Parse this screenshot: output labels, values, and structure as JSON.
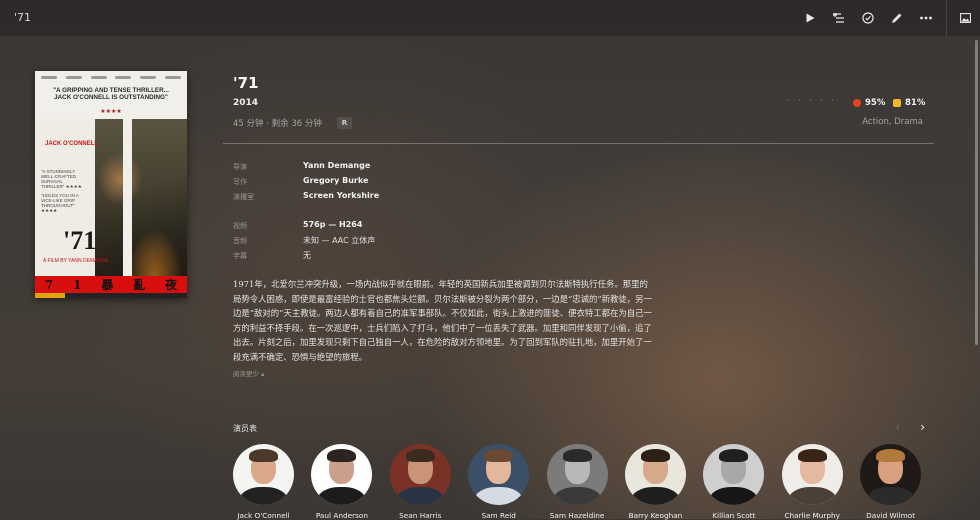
{
  "window": {
    "title": "'71"
  },
  "toolbar": {
    "icons": [
      "play-icon",
      "add-to-queue-icon",
      "watched-check-icon",
      "edit-pencil-icon",
      "more-ellipsis-icon",
      "artwork-image-icon"
    ]
  },
  "poster": {
    "quote": "\"A GRIPPING AND TENSE THRILLER... JACK O'CONNELL IS OUTSTANDING\"",
    "stars": "★★★★",
    "actor": "JACK O'CONNELL",
    "quote2": "\"A STUNNINGLY WELL-CRAFTED SURVIVAL THRILLER\" ★★★★",
    "quote3": "\"HOLDS YOU IN A VICE-LIKE GRIP THROUGHOUT\" ★★★★",
    "title": "'71",
    "director": "A FILM BY YANN DEMANGE",
    "chinese_title": [
      "7",
      "1",
      "暴",
      "亂",
      "夜"
    ],
    "progress": 0.2
  },
  "header": {
    "title": "'71",
    "year": "2014",
    "meta": "45 分钟 · 剩余 36 分钟",
    "content_rating": "R",
    "dots": "· · · · ·",
    "critic_score": "95%",
    "audience_score": "81%",
    "genres": "Action, Drama",
    "colors": {
      "critic": "#e2461f",
      "audience": "#f5b629"
    }
  },
  "credits": [
    {
      "label": "导演",
      "value": "Yann Demange"
    },
    {
      "label": "写作",
      "value": "Gregory Burke"
    },
    {
      "label": "演播室",
      "value": "Screen Yorkshire"
    }
  ],
  "media": [
    {
      "label": "视频",
      "value": "576p — H264"
    },
    {
      "label": "音频",
      "value": "未知 — AAC 立体声"
    },
    {
      "label": "字幕",
      "value": "无"
    }
  ],
  "summary": {
    "lines": [
      "1971年，北爱尔兰冲突升级，一场内战似乎就在眼前。年轻的英国新兵加里被调到贝尔法斯特执行任务。那里的",
      "局势令人困惑，即使是最富经验的士官也都焦头烂额。贝尔法斯被分裂为两个部分，一边是“忠诚的”新教徒，另一",
      "边是“敌对的”天主教徒。两边人都有着自己的准军事部队。不仅如此，街头上激进的匪徒、便衣特工都在为自己一",
      "方的利益不择手段。在一次巡逻中，士兵们陷入了打斗，他们中了一位丢失了武器。加里和同伴发现了小偷，追了",
      "出去。片刻之后，加里发现只剩下自己独自一人，在危险的敌对方领地里。为了回到军队的驻扎地，加里开始了一",
      "段充满不确定、恐惧与绝望的旅程。"
    ],
    "read_less": "阅读更少 ▴"
  },
  "cast": {
    "heading": "演员表",
    "members": [
      {
        "name": "Jack O'Connell",
        "bg": "#f4f4f2",
        "skin": "#d9a98a",
        "hair": "#4b3a2c",
        "body": "#222222"
      },
      {
        "name": "Paul Anderson",
        "bg": "#ffffff",
        "skin": "#caa08a",
        "hair": "#2b2420",
        "body": "#1c1c1c"
      },
      {
        "name": "Sean Harris",
        "bg": "#7a3226",
        "skin": "#c99478",
        "hair": "#3a2a20",
        "body": "#2a3346"
      },
      {
        "name": "Sam Reid",
        "bg": "#3b4f66",
        "skin": "#e2b79b",
        "hair": "#6a4a32",
        "body": "#d5dbe2"
      },
      {
        "name": "Sam Hazeldine",
        "bg": "#7b7b7b",
        "skin": "#b8b8b8",
        "hair": "#2a2a2a",
        "body": "#3a3a3a"
      },
      {
        "name": "Barry Keoghan",
        "bg": "#e9e6de",
        "skin": "#d6a98b",
        "hair": "#2c2017",
        "body": "#1e1e1e"
      },
      {
        "name": "Killian Scott",
        "bg": "#cfcfcf",
        "skin": "#a8a8a8",
        "hair": "#1f1f1f",
        "body": "#161616"
      },
      {
        "name": "Charlie Murphy",
        "bg": "#f0ece8",
        "skin": "#e4b9a0",
        "hair": "#3a2418",
        "body": "#4a4036"
      },
      {
        "name": "David Wilmot",
        "bg": "#1f1a17",
        "skin": "#d8a07e",
        "hair": "#b07a3a",
        "body": "#2b2b2b"
      }
    ]
  }
}
